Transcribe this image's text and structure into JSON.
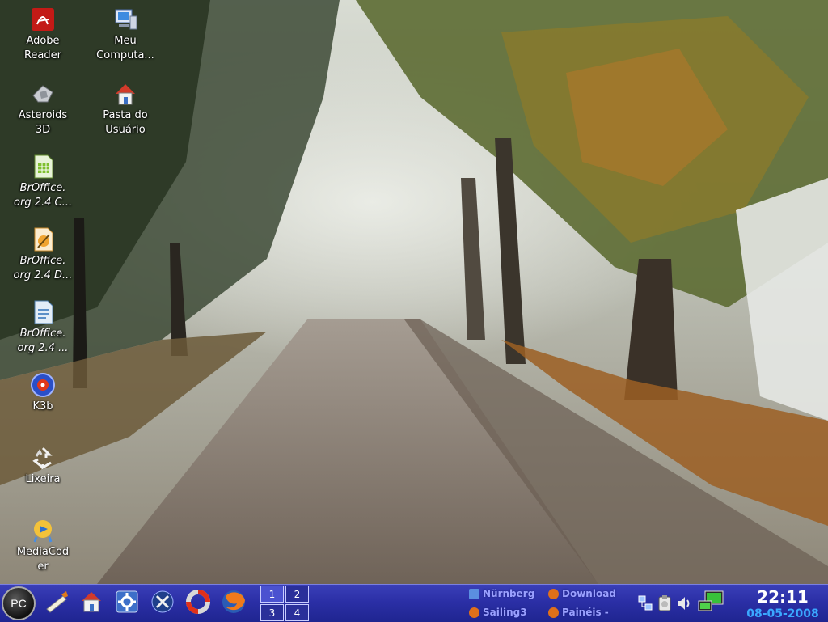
{
  "desktop": {
    "icons": [
      {
        "label": "Adobe\nReader",
        "icon": "pdf-icon",
        "italic": false
      },
      {
        "label": "Meu\nComputa...",
        "icon": "computer-icon",
        "italic": false
      },
      {
        "label": "Asteroids\n3D",
        "icon": "game-icon",
        "italic": false
      },
      {
        "label": "Pasta do\nUsuário",
        "icon": "home-folder-icon",
        "italic": false
      },
      {
        "label": "BrOffice.\norg 2.4 C...",
        "icon": "spreadsheet-icon",
        "italic": true
      },
      {
        "label": "BrOffice.\norg 2.4 D...",
        "icon": "drawing-icon",
        "italic": true
      },
      {
        "label": "BrOffice.\norg 2.4 ...",
        "icon": "presentation-icon",
        "italic": true
      },
      {
        "label": "K3b",
        "icon": "disc-burn-icon",
        "italic": false
      },
      {
        "label": "Lixeira",
        "icon": "trash-icon",
        "italic": false
      },
      {
        "label": "MediaCod\ner",
        "icon": "media-encoder-icon",
        "italic": false
      }
    ]
  },
  "taskbar": {
    "menu_label": "PC",
    "launchers": [
      "pen-edit-icon",
      "home-icon",
      "system-settings-icon",
      "tools-icon",
      "help-lifebuoy-icon",
      "firefox-icon"
    ],
    "pager": [
      "1",
      "2",
      "3",
      "4"
    ],
    "tasks": [
      {
        "label": "Nürnberg",
        "icon": "folder-icon"
      },
      {
        "label": "Download",
        "icon": "firefox-icon"
      },
      {
        "label": "Sailing3",
        "icon": "firefox-icon"
      },
      {
        "label": "Painéis -",
        "icon": "firefox-icon"
      }
    ],
    "tray": [
      "network-icon",
      "clipboard-icon",
      "volume-icon",
      "network-manager-icon"
    ],
    "clock": {
      "time": "22:11",
      "date": "08-05-2008"
    }
  },
  "colors": {
    "taskbar": "#2b2fa6",
    "date": "#3aa8ff"
  }
}
